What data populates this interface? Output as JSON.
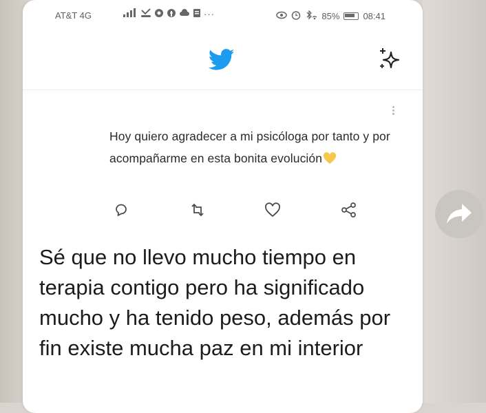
{
  "status_bar": {
    "carrier": "AT&T 4G",
    "battery_percent": "85%",
    "time": "08:41"
  },
  "header": {
    "logo_icon": "twitter-bird-icon",
    "sparkle_icon": "sparkle-icon"
  },
  "tweet": {
    "text": "Hoy quiero agradecer a mi psicóloga por tanto y por acompañarme en esta bonita evolución",
    "emoji": "yellow-heart-icon",
    "actions": [
      "reply-icon",
      "retweet-icon",
      "like-icon",
      "share-icon"
    ]
  },
  "message": {
    "text": "Sé que no llevo mucho tiempo en terapia contigo pero ha significado mucho y ha tenido peso, además por fin existe mucha paz en mi interior"
  },
  "colors": {
    "twitter_blue": "#1d9bf0",
    "emoji_yellow": "#f5c84c",
    "forward_button": "#c9c5c1"
  }
}
